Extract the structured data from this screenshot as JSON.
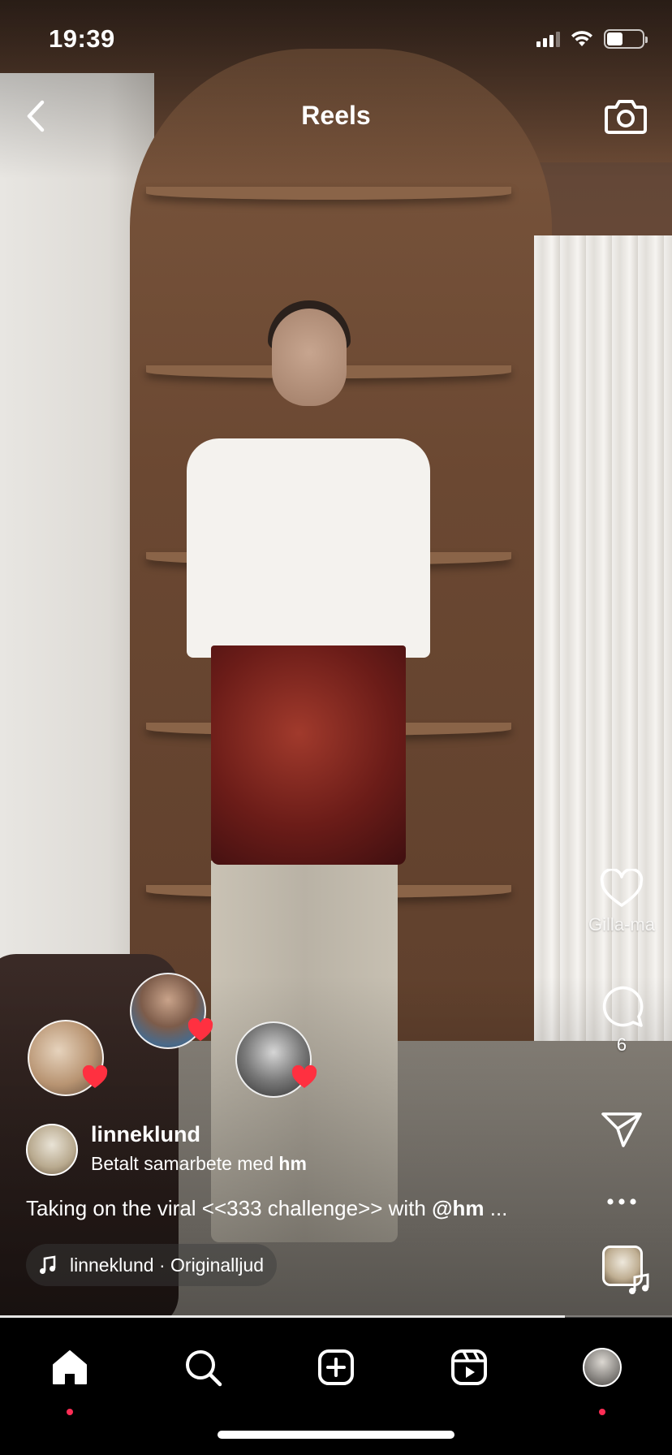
{
  "status_bar": {
    "time": "19:39",
    "battery_level": 0.45
  },
  "header": {
    "title": "Reels",
    "back_icon": "chevron-left-icon",
    "camera_icon": "camera-icon"
  },
  "actions": {
    "like_label": "Gilla-ma",
    "comment_count": "6",
    "like_icon": "heart-outline-icon",
    "comment_icon": "comment-bubble-icon",
    "share_icon": "paper-plane-icon",
    "more_icon": "more-dots-icon"
  },
  "post": {
    "username": "linneklund",
    "sponsor_prefix": "Betalt samarbete med",
    "sponsor_brand": "hm",
    "caption_text": "Taking on the viral <<333 challenge>> with",
    "caption_mention": "@hm",
    "caption_more": "...",
    "audio_label": "linneklund · Originalljud"
  },
  "playback": {
    "progress": 0.84
  },
  "tabbar": {
    "items": [
      "home",
      "search",
      "create",
      "reels",
      "profile"
    ],
    "active": "home"
  },
  "colors": {
    "accent_red": "#ff3040",
    "notification_dot": "#ff2d55",
    "tabbar_bg": "#000000"
  }
}
